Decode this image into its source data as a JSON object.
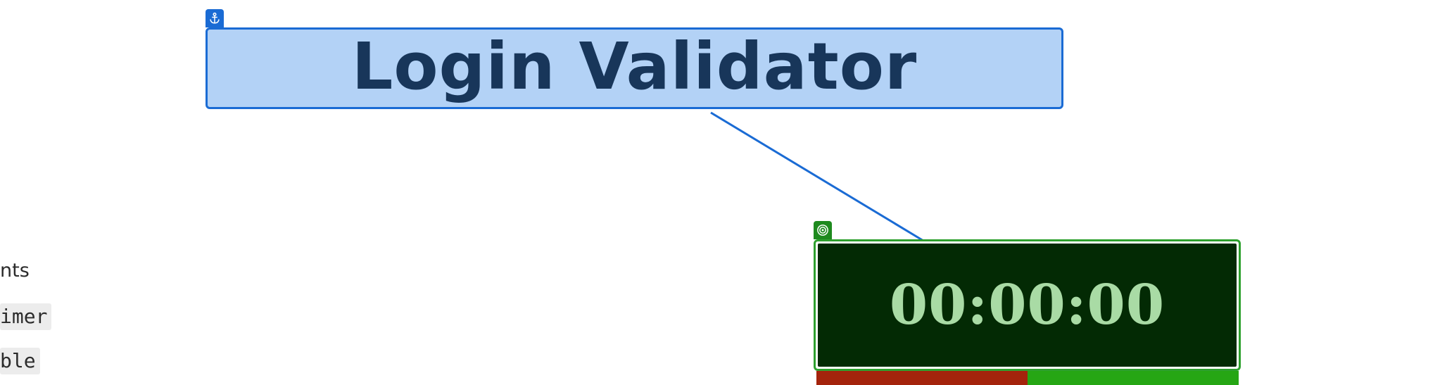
{
  "sidebar": {
    "items": [
      {
        "label": "nts",
        "style": "plain"
      },
      {
        "label": "imer",
        "style": "code"
      },
      {
        "label": "ble",
        "style": "code"
      }
    ]
  },
  "title_node": {
    "text": "Login Validator",
    "badge_icon": "anchor-icon",
    "color_fill": "#b3d2f6",
    "color_border": "#1a6bd4",
    "color_text": "#18365a"
  },
  "timer_node": {
    "text": "00:00:00",
    "badge_icon": "target-icon",
    "color_border": "#2ea02e",
    "color_background": "#032a04",
    "color_text": "#a9dba5"
  },
  "buttons": {
    "stop_color": "#a4230c",
    "start_color": "#26a614"
  }
}
